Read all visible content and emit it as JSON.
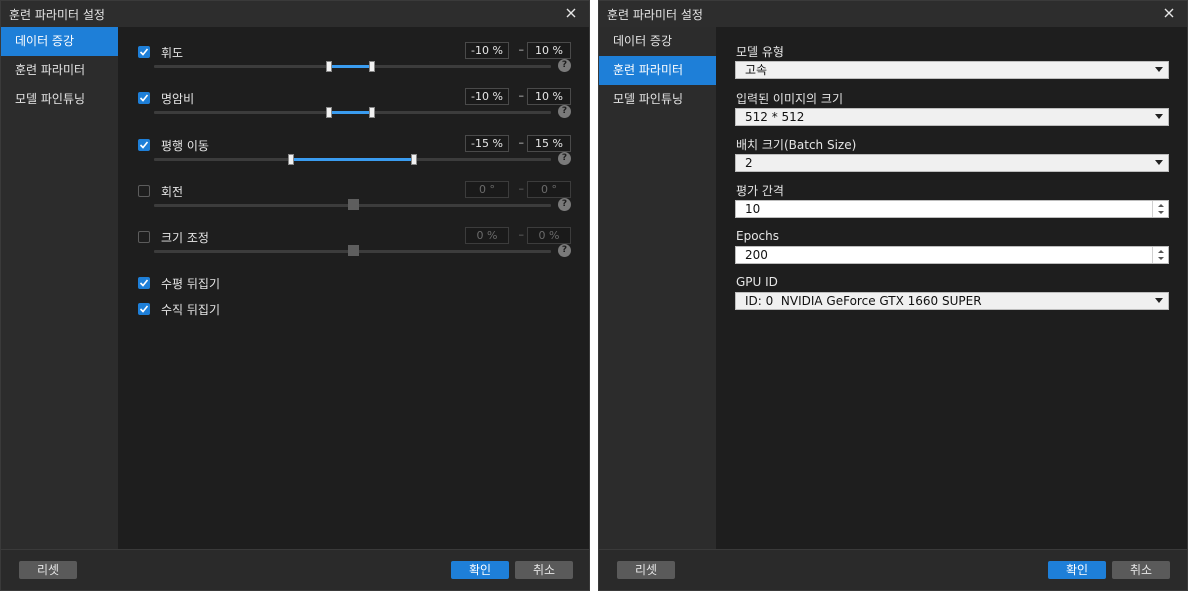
{
  "left_dialog": {
    "title": "훈련 파라미터 설정",
    "sidebar": [
      "데이터 증강",
      "훈련 파라미터",
      "모델 파인튜닝"
    ],
    "augment": [
      {
        "label": "휘도",
        "checked": true,
        "min": "-10 %",
        "max": "10 %"
      },
      {
        "label": "명암비",
        "checked": true,
        "min": "-10 %",
        "max": "10 %"
      },
      {
        "label": "평행 이동",
        "checked": true,
        "min": "-15 %",
        "max": "15 %"
      },
      {
        "label": "회전",
        "checked": false,
        "min": "0 °",
        "max": "0 °"
      },
      {
        "label": "크기 조정",
        "checked": false,
        "min": "0 %",
        "max": "0 %"
      }
    ],
    "flips": [
      {
        "label": "수평 뒤집기",
        "checked": true
      },
      {
        "label": "수직 뒤집기",
        "checked": true
      }
    ],
    "dash": "–",
    "help": "?",
    "reset": "리셋",
    "ok": "확인",
    "cancel": "취소"
  },
  "right_dialog": {
    "title": "훈련 파라미터",
    "sidebar": [
      "데이터 증강",
      "훈련 파라미터",
      "모델 파인튜닝"
    ],
    "fields": {
      "model_type": {
        "label": "모델 유형",
        "value": "고속"
      },
      "input_size": {
        "label": "입력된 이미지의 크기",
        "value": "512 * 512"
      },
      "batch_size": {
        "label": "배치 크기(Batch Size)",
        "value": "2"
      },
      "eval_interval": {
        "label": "평가 간격",
        "value": "10"
      },
      "epochs": {
        "label": "Epochs",
        "value": "200"
      },
      "gpu_id": {
        "label": "GPU ID",
        "value": "ID: 0  NVIDIA GeForce GTX 1660 SUPER"
      }
    },
    "reset": "리셋",
    "ok": "확인",
    "cancel": "취소"
  },
  "colors": {
    "accent": "#1e7fd8",
    "background": "#1e1e1e",
    "sidebar": "#2c2c2c"
  },
  "icons": [
    "close-icon",
    "checkmark-icon",
    "help-icon",
    "dropdown-arrow-icon",
    "spin-up-icon",
    "spin-down-icon"
  ]
}
